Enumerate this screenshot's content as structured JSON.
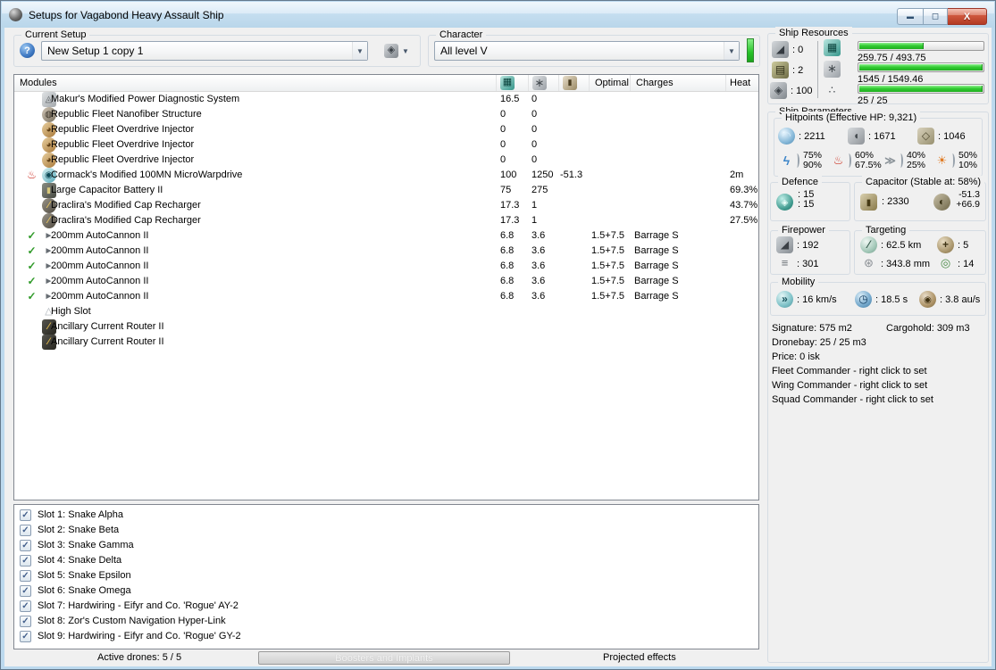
{
  "window": {
    "title": "Setups for Vagabond Heavy Assault Ship"
  },
  "setup": {
    "label": "Current Setup",
    "value": "New Setup 1 copy 1"
  },
  "character": {
    "label": "Character",
    "value": "All level V"
  },
  "modules": {
    "title": "Modules",
    "columns": {
      "optimal": "Optimal",
      "charges": "Charges",
      "heat": "Heat"
    },
    "rows": [
      {
        "status": "",
        "icon": "power-diagnostic-icon",
        "name": "Makur's Modified Power Diagnostic System",
        "cpu": "16.5",
        "pg": "0",
        "cap": "",
        "optimal": "",
        "charges": "",
        "heat": ""
      },
      {
        "status": "",
        "icon": "nanofiber-icon",
        "name": "Republic Fleet Nanofiber Structure",
        "cpu": "0",
        "pg": "0",
        "cap": "",
        "optimal": "",
        "charges": "",
        "heat": ""
      },
      {
        "status": "",
        "icon": "overdrive-icon",
        "name": "Republic Fleet Overdrive Injector",
        "cpu": "0",
        "pg": "0",
        "cap": "",
        "optimal": "",
        "charges": "",
        "heat": ""
      },
      {
        "status": "",
        "icon": "overdrive-icon",
        "name": "Republic Fleet Overdrive Injector",
        "cpu": "0",
        "pg": "0",
        "cap": "",
        "optimal": "",
        "charges": "",
        "heat": ""
      },
      {
        "status": "",
        "icon": "overdrive-icon",
        "name": "Republic Fleet Overdrive Injector",
        "cpu": "0",
        "pg": "0",
        "cap": "",
        "optimal": "",
        "charges": "",
        "heat": ""
      },
      {
        "status": "overheat",
        "icon": "mwd-icon",
        "name": "Cormack's Modified 100MN MicroWarpdrive",
        "cpu": "100",
        "pg": "1250",
        "cap": "-51.3",
        "optimal": "",
        "charges": "",
        "heat": "2m"
      },
      {
        "status": "",
        "icon": "battery-icon",
        "name": "Large Capacitor Battery II",
        "cpu": "75",
        "pg": "275",
        "cap": "",
        "optimal": "",
        "charges": "",
        "heat": "69.3%"
      },
      {
        "status": "",
        "icon": "recharger-icon",
        "name": "Draclira's Modified Cap Recharger",
        "cpu": "17.3",
        "pg": "1",
        "cap": "",
        "optimal": "",
        "charges": "",
        "heat": "43.7%"
      },
      {
        "status": "",
        "icon": "recharger-icon",
        "name": "Draclira's Modified Cap Recharger",
        "cpu": "17.3",
        "pg": "1",
        "cap": "",
        "optimal": "",
        "charges": "",
        "heat": "27.5%"
      },
      {
        "status": "fitted",
        "icon": "autocannon-icon",
        "name": "200mm AutoCannon II",
        "cpu": "6.8",
        "pg": "3.6",
        "cap": "",
        "optimal": "1.5+7.5",
        "charges": "Barrage S",
        "heat": ""
      },
      {
        "status": "fitted",
        "icon": "autocannon-icon",
        "name": "200mm AutoCannon II",
        "cpu": "6.8",
        "pg": "3.6",
        "cap": "",
        "optimal": "1.5+7.5",
        "charges": "Barrage S",
        "heat": ""
      },
      {
        "status": "fitted",
        "icon": "autocannon-icon",
        "name": "200mm AutoCannon II",
        "cpu": "6.8",
        "pg": "3.6",
        "cap": "",
        "optimal": "1.5+7.5",
        "charges": "Barrage S",
        "heat": ""
      },
      {
        "status": "fitted",
        "icon": "autocannon-icon",
        "name": "200mm AutoCannon II",
        "cpu": "6.8",
        "pg": "3.6",
        "cap": "",
        "optimal": "1.5+7.5",
        "charges": "Barrage S",
        "heat": ""
      },
      {
        "status": "fitted",
        "icon": "autocannon-icon",
        "name": "200mm AutoCannon II",
        "cpu": "6.8",
        "pg": "3.6",
        "cap": "",
        "optimal": "1.5+7.5",
        "charges": "Barrage S",
        "heat": ""
      },
      {
        "status": "",
        "icon": "high-slot-icon",
        "name": "High Slot",
        "cpu": "",
        "pg": "",
        "cap": "",
        "optimal": "",
        "charges": "",
        "heat": ""
      },
      {
        "status": "",
        "icon": "rig-icon",
        "name": "Ancillary Current Router II",
        "cpu": "",
        "pg": "",
        "cap": "",
        "optimal": "",
        "charges": "",
        "heat": ""
      },
      {
        "status": "",
        "icon": "rig-icon",
        "name": "Ancillary Current Router II",
        "cpu": "",
        "pg": "",
        "cap": "",
        "optimal": "",
        "charges": "",
        "heat": ""
      }
    ]
  },
  "implants": {
    "items": [
      {
        "label": "Slot 1: Snake Alpha",
        "checked": true
      },
      {
        "label": "Slot 2: Snake Beta",
        "checked": true
      },
      {
        "label": "Slot 3: Snake Gamma",
        "checked": true
      },
      {
        "label": "Slot 4: Snake Delta",
        "checked": true
      },
      {
        "label": "Slot 5: Snake Epsilon",
        "checked": true
      },
      {
        "label": "Slot 6: Snake Omega",
        "checked": true
      },
      {
        "label": "Slot 7: Hardwiring - Eifyr and Co. 'Rogue' AY-2",
        "checked": true
      },
      {
        "label": "Slot 8: Zor's Custom Navigation Hyper-Link",
        "checked": true
      },
      {
        "label": "Slot 9: Hardwiring - Eifyr and Co. 'Rogue' GY-2",
        "checked": true
      }
    ]
  },
  "bottom_bar": {
    "active_drones": "Active drones: 5 / 5",
    "boosters": "Boosters and Implants",
    "projected": "Projected effects"
  },
  "ship_resources": {
    "title": "Ship Resources",
    "turrets": "0",
    "launchers": "2",
    "calibration": "100",
    "cpu": {
      "text": "259.75 / 493.75",
      "pct": 52.6
    },
    "powergrid": {
      "text": "1545 / 1549.46",
      "pct": 99.7
    },
    "drones": {
      "text": "25 / 25",
      "pct": 100
    },
    "bar_color": "#34cc34"
  },
  "ship_parameters": {
    "title": "Ship Parameters",
    "hitpoints": {
      "title": "Hitpoints (Effective HP: 9,321)",
      "shield": "2211",
      "armor": "1671",
      "hull": "1046",
      "resists": [
        {
          "type": "em",
          "top": "75%",
          "bottom": "90%"
        },
        {
          "type": "thermal",
          "top": "60%",
          "bottom": "67.5%"
        },
        {
          "type": "kinetic",
          "top": "40%",
          "bottom": "25%"
        },
        {
          "type": "explosive",
          "top": "50%",
          "bottom": "10%"
        }
      ]
    },
    "defence": {
      "title": "Defence",
      "line1": "15",
      "line2": "15"
    },
    "capacitor": {
      "title": "Capacitor (Stable at: 58%)",
      "amount": "2330",
      "drain": "-51.3",
      "recharge": "+66.9"
    },
    "firepower": {
      "title": "Firepower",
      "dps": "192",
      "volley": "301"
    },
    "targeting": {
      "title": "Targeting",
      "range": "62.5 km",
      "max_targets": "5",
      "scan_res": "343.8 mm",
      "sensor_strength": "14"
    },
    "mobility": {
      "title": "Mobility",
      "speed": "16 km/s",
      "align_time": "18.5 s",
      "warp_speed": "3.8 au/s"
    },
    "info": {
      "signature": "Signature: 575 m2",
      "cargohold": "Cargohold: 309 m3",
      "dronebay": "Dronebay: 25 / 25 m3",
      "price": "Price: 0 isk",
      "fleet": "Fleet Commander - right click to set",
      "wing": "Wing Commander - right click to set",
      "squad": "Squad Commander - right click to set"
    }
  }
}
